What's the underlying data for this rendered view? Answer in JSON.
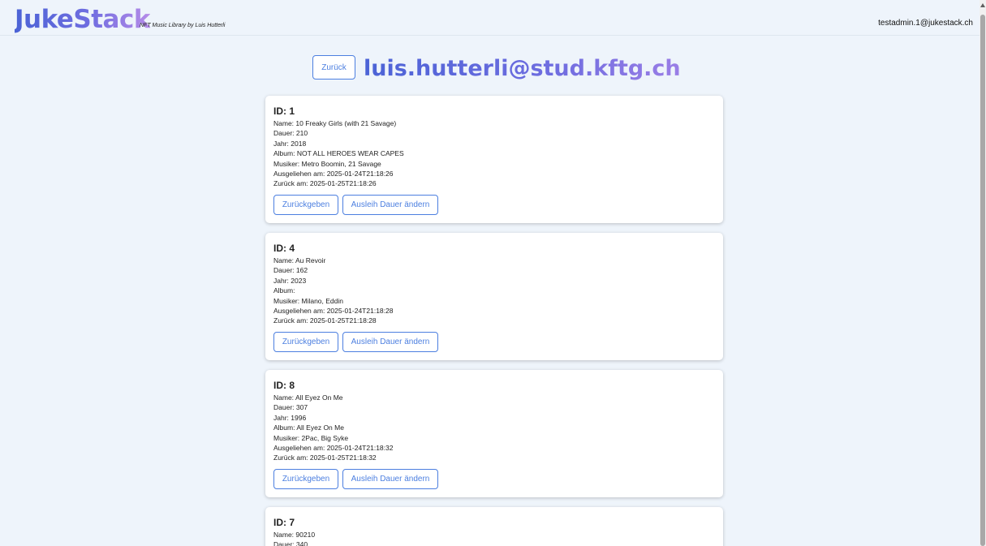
{
  "app": {
    "logo": "JukeStack",
    "tagline": "NFT Music Library by Luis Hutterli",
    "user_email": "testadmin.1@jukestack.ch"
  },
  "header": {
    "back_label": "Zurück",
    "owner_email": "luis.hutterli@stud.kftg.ch"
  },
  "labels": {
    "id": "ID:",
    "name": "Name:",
    "dauer": "Dauer:",
    "jahr": "Jahr:",
    "album": "Album:",
    "musiker": "Musiker:",
    "ausgeliehen": "Ausgeliehen am:",
    "zurueck": "Zurück am:",
    "return_button": "Zurückgeben",
    "change_button": "Ausleih Dauer ändern"
  },
  "cards": [
    {
      "id": "1",
      "name": "10 Freaky Girls (with 21 Savage)",
      "dauer": "210",
      "jahr": "2018",
      "album": "NOT ALL HEROES WEAR CAPES",
      "musiker": "Metro Boomin, 21 Savage",
      "ausgeliehen": "2025-01-24T21:18:26",
      "zurueck": "2025-01-25T21:18:26"
    },
    {
      "id": "4",
      "name": "Au Revoir",
      "dauer": "162",
      "jahr": "2023",
      "album": "",
      "musiker": "Milano, Eddin",
      "ausgeliehen": "2025-01-24T21:18:28",
      "zurueck": "2025-01-25T21:18:28"
    },
    {
      "id": "8",
      "name": "All Eyez On Me",
      "dauer": "307",
      "jahr": "1996",
      "album": "All Eyez On Me",
      "musiker": "2Pac, Big Syke",
      "ausgeliehen": "2025-01-24T21:18:32",
      "zurueck": "2025-01-25T21:18:32"
    },
    {
      "id": "7",
      "name": "90210",
      "dauer": "340"
    }
  ]
}
